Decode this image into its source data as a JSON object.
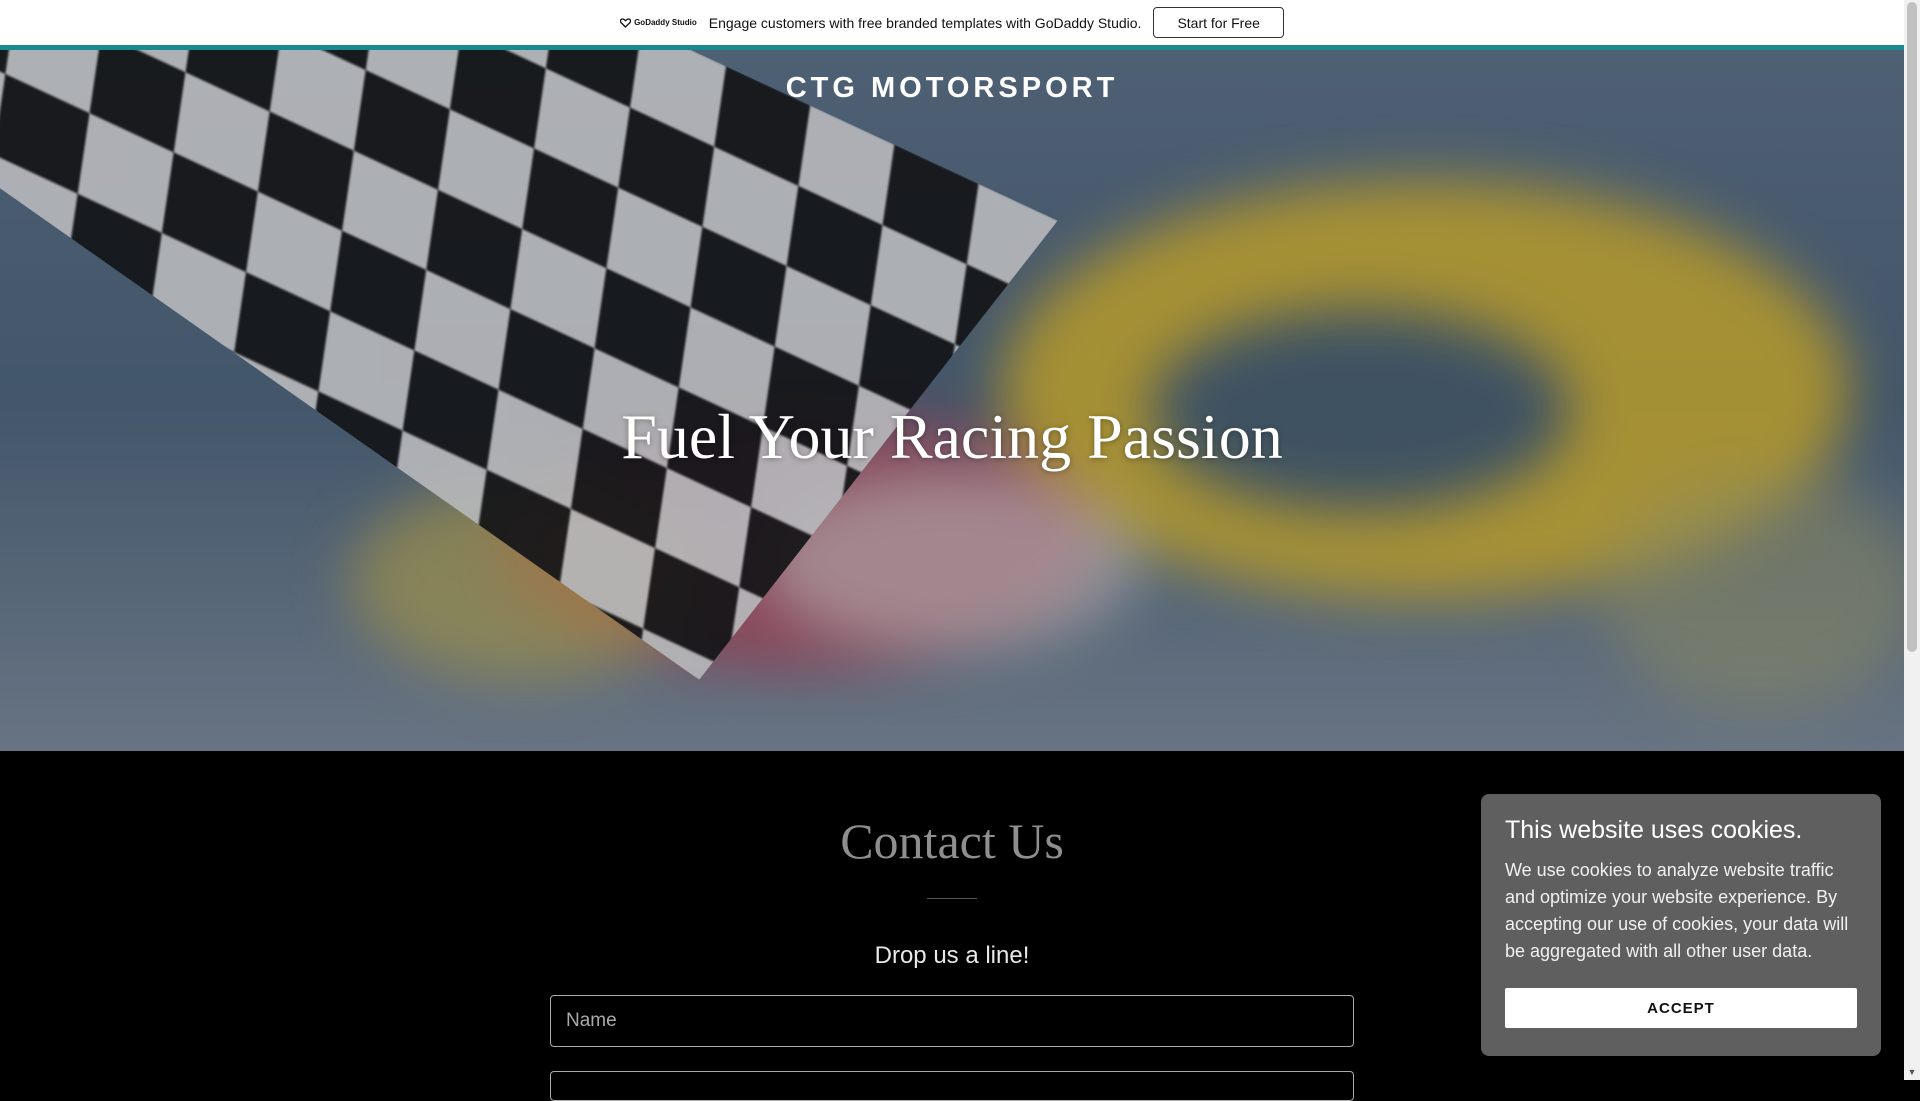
{
  "promo": {
    "logo_text": "GoDaddy Studio",
    "message": "Engage customers with free branded templates with GoDaddy Studio.",
    "cta_label": "Start for Free",
    "accent_color": "#1a8a8f"
  },
  "hero": {
    "site_title": "CTG MOTORSPORT",
    "heading": "Fuel Your Racing Passion"
  },
  "contact": {
    "title": "Contact Us",
    "subtitle": "Drop us a line!",
    "name_placeholder": "Name"
  },
  "cookie": {
    "title": "This website uses cookies.",
    "body": "We use cookies to analyze website traffic and optimize your website experience. By accepting our use of cookies, your data will be aggregated with all other user data.",
    "accept_label": "ACCEPT"
  }
}
